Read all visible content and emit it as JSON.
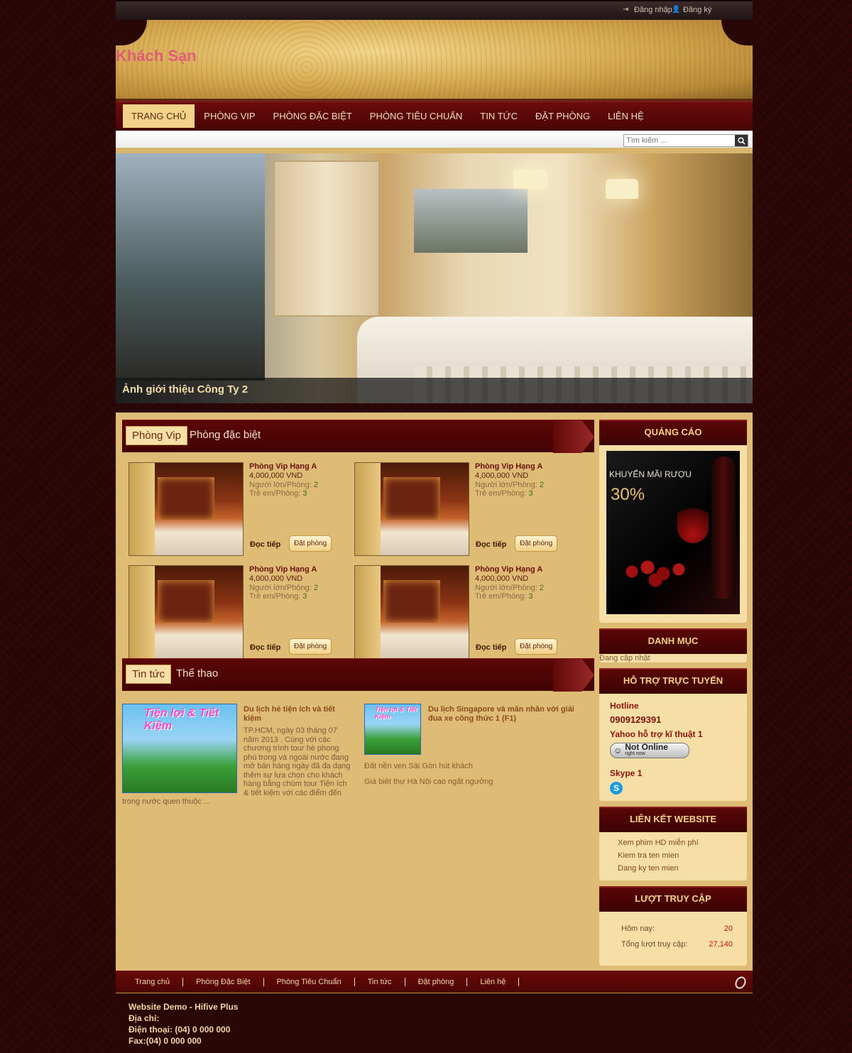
{
  "topbar": {
    "login_label": "Đăng nhập",
    "register_label": "Đăng ký"
  },
  "header": {
    "site_name": "Khách Sạn"
  },
  "nav": {
    "items": [
      "TRANG CHỦ",
      "PHÒNG VIP",
      "PHÒNG ĐẶC BIỆT",
      "PHÒNG TIÊU CHUẨN",
      "TIN TỨC",
      "ĐẶT PHÒNG",
      "LIÊN HỆ"
    ],
    "active": "TRANG CHỦ"
  },
  "search": {
    "placeholder": "Tìm kiếm ..."
  },
  "slider": {
    "caption": "Ảnh giới thiệu Công Ty 2"
  },
  "rooms_section": {
    "tab_active": "Phòng Vip",
    "tab_other": "Phòng đặc biệt"
  },
  "rooms": [
    {
      "name": "Phòng Vip Hạng A",
      "price": "4,000,000 VND",
      "adults_label": "Người lớn/Phòng:",
      "adults": "2",
      "children_label": "Trẻ em/Phòng:",
      "children": "3",
      "more": "Đọc tiếp",
      "book": "Đặt phòng"
    },
    {
      "name": "Phòng Vip Hạng A",
      "price": "4,000,000 VND",
      "adults_label": "Người lớn/Phòng:",
      "adults": "2",
      "children_label": "Trẻ em/Phòng:",
      "children": "3",
      "more": "Đọc tiếp",
      "book": "Đặt phòng"
    },
    {
      "name": "Phòng Vip Hạng A",
      "price": "4,000,000 VND",
      "adults_label": "Người lớn/Phòng:",
      "adults": "2",
      "children_label": "Trẻ em/Phòng:",
      "children": "3",
      "more": "Đọc tiếp",
      "book": "Đặt phòng"
    },
    {
      "name": "Phòng Vip Hạng A",
      "price": "4,000,000 VND",
      "adults_label": "Người lớn/Phòng:",
      "adults": "2",
      "children_label": "Trẻ em/Phòng:",
      "children": "3",
      "more": "Đọc tiếp",
      "book": "Đặt phòng"
    }
  ],
  "news_section": {
    "tab_active": "Tin tức",
    "tab_other": "Thể thao"
  },
  "news": {
    "main_title": "Du lịch hè tiện ích và tiết kiệm",
    "main_body": "TP.HCM, ngày 03 tháng 07 năm 2013 . Cùng với các chương trình tour hè phong phú trong và ngoài nước đang mở bán hàng ngày đã đa dạng thêm sự lựa chọn cho khách hàng bằng chùm tour Tiện ích & tiết kiệm với các điểm đến",
    "main_body_tail": "trong nước quen thuộc ...",
    "main_img_text": "Tiện lợi & Tiết Kiệm",
    "second_title": "Du lịch Singapore và mãn nhãn với giải đua xe công thức 1 (F1)",
    "second_img_text": "Tiện lợi & Tiết Kiệm",
    "links": [
      "Đất nền ven Sài Gòn hút khách",
      "Giá biệt thự Hà Nội cao ngất ngưởng"
    ]
  },
  "sidebar": {
    "ads_title": "QUẢNG CÁO",
    "ad_text": "KHUYẾN MÃI RƯỢU",
    "ad_percent": "30%",
    "category_title": "DANH MỤC",
    "category_text": "Đang cập nhật",
    "support_title": "HỖ TRỢ TRỰC TUYẾN",
    "hotline_label": "Hotline",
    "hotline_value": "0909129391",
    "yahoo_label": "Yahoo hỗ trợ kĩ thuật 1",
    "online_status": "Not Online",
    "online_sub": "right now",
    "skype_label": "Skype 1",
    "links_title": "LIÊN KẾT WEBSITE",
    "links": [
      "Xem phim HD miễn phí",
      "Kiem tra ten mien",
      "Dang ky ten mien"
    ],
    "stats_title": "LƯỢT TRUY CẬP",
    "today_label": "Hôm nay:",
    "today_value": "20",
    "total_label": "Tổng lượt truy cập:",
    "total_value": "27,140"
  },
  "footer": {
    "nav": [
      "Trang chủ",
      "Phòng Đặc Biệt",
      "Phòng Tiêu Chuẩn",
      "Tin tức",
      "Đặt phòng",
      "Liên hệ"
    ],
    "site": "Website Demo - Hifive Plus",
    "address_label": "Địa chỉ:",
    "phone": "Điện thoại: (04) 0 000 000",
    "fax": "Fax:(04) 0 000 000"
  }
}
